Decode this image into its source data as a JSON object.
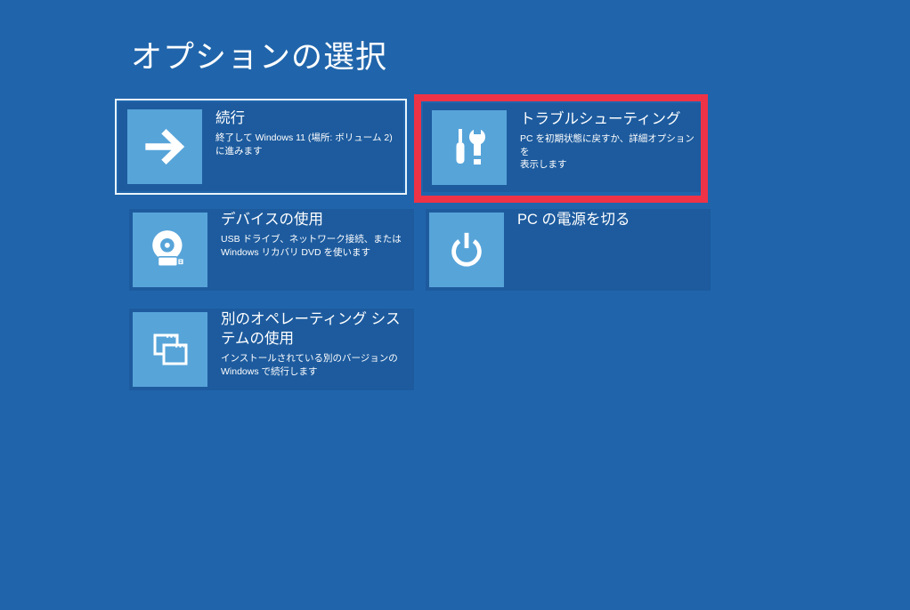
{
  "page": {
    "title": "オプションの選択"
  },
  "colors": {
    "background": "#2065ab",
    "tile": "#1d5b9e",
    "icon_square": "#57a4d9",
    "text": "#ffffff",
    "focus_ring": "#e9f5fc",
    "highlight_annotation": "#ee3347"
  },
  "tiles": [
    {
      "id": "continue",
      "icon": "arrow-right-icon",
      "title": "続行",
      "description": "終了して Windows 11 (場所: ボリューム 2)\nに進みます",
      "focused": true
    },
    {
      "id": "troubleshoot",
      "icon": "tools-icon",
      "title": "トラブルシューティング",
      "description": "PC を初期状態に戻すか、詳細オプションを\n表示します",
      "highlighted": true
    },
    {
      "id": "use-device",
      "icon": "disc-usb-icon",
      "title": "デバイスの使用",
      "description": "USB ドライブ、ネットワーク接続、または\nWindows リカバリ DVD を使います"
    },
    {
      "id": "power-off",
      "icon": "power-icon",
      "title": "PC の電源を切る",
      "description": ""
    },
    {
      "id": "other-os",
      "icon": "windows-icon",
      "title": "別のオペレーティング シス\nテムの使用",
      "description": "インストールされている別のバージョンの\nWindows で続行します"
    }
  ]
}
